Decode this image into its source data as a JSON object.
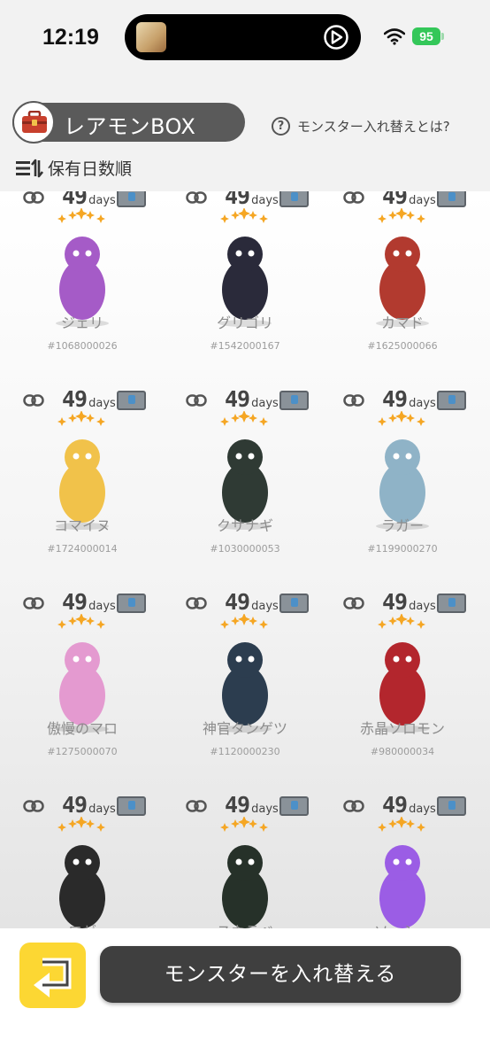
{
  "status": {
    "time": "12:19",
    "battery": "95"
  },
  "header": {
    "title": "レアモンBOX",
    "help_text": "モンスター入れ替えとは?",
    "sort_label": "保有日数順"
  },
  "card_unit": "days",
  "rows": [
    [
      {
        "days": "49",
        "name": "ジェリ",
        "id": "#1068000026",
        "color": "#a55bc7"
      },
      {
        "days": "49",
        "name": "グリゴリ",
        "id": "#1542000167",
        "color": "#2a2a3a"
      },
      {
        "days": "49",
        "name": "カマド",
        "id": "#1625000066",
        "color": "#b23a2f"
      }
    ],
    [
      {
        "days": "49",
        "name": "コマイヌ",
        "id": "#1724000014",
        "color": "#f1c24a"
      },
      {
        "days": "49",
        "name": "クサナギ",
        "id": "#1030000053",
        "color": "#2f3a34"
      },
      {
        "days": "49",
        "name": "ラガー",
        "id": "#1199000270",
        "color": "#8fb3c7"
      }
    ],
    [
      {
        "days": "49",
        "name": "傲慢のマロ",
        "id": "#1275000070",
        "color": "#e49ad0"
      },
      {
        "days": "49",
        "name": "神官タンゲツ",
        "id": "#1120000230",
        "color": "#2c3d4f"
      },
      {
        "days": "49",
        "name": "赤晶ソロモン",
        "id": "#980000034",
        "color": "#b3262d"
      }
    ],
    [
      {
        "days": "49",
        "name": "ロゼ",
        "id": "",
        "color": "#2a2a2a"
      },
      {
        "days": "49",
        "name": "スカラベ",
        "id": "",
        "color": "#263129"
      },
      {
        "days": "49",
        "name": "ソッシー",
        "id": "",
        "color": "#9b5de5"
      }
    ]
  ],
  "footer": {
    "swap_button": "モンスターを入れ替える"
  },
  "colors": {
    "accent_yellow": "#fcd733",
    "button_dark": "#3f3f3f",
    "star": "#f5a623"
  }
}
